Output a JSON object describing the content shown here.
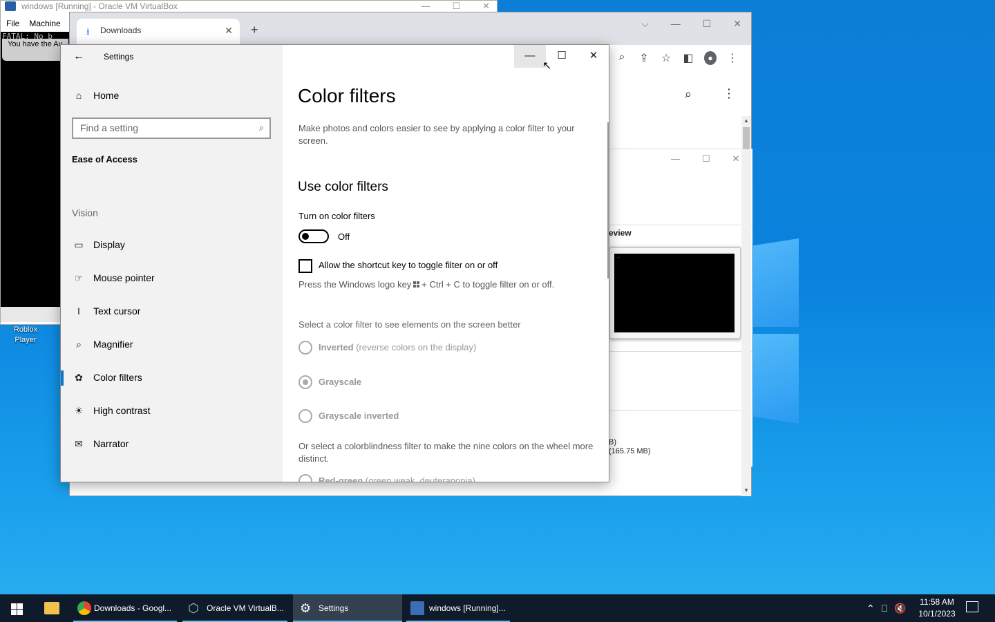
{
  "virtualbox": {
    "title": "windows [Running] - Oracle VM VirtualBox",
    "menu": [
      "File",
      "Machine"
    ],
    "screen_text": "FATAL: No b",
    "banner_text": "You have the Au"
  },
  "desktop_icons": [
    {
      "label": "Roblox Player"
    }
  ],
  "chrome": {
    "tab_title": "Downloads",
    "inner_section": "eview",
    "size_line1": "B)",
    "size_line2": "(165.75 MB)"
  },
  "settings": {
    "app_title": "Settings",
    "home_label": "Home",
    "search_placeholder": "Find a setting",
    "category": "Ease of Access",
    "group_label": "Vision",
    "nav_items": [
      {
        "label": "Display",
        "icon": "display-icon"
      },
      {
        "label": "Mouse pointer",
        "icon": "mouse-pointer-icon"
      },
      {
        "label": "Text cursor",
        "icon": "text-cursor-icon"
      },
      {
        "label": "Magnifier",
        "icon": "magnifier-icon"
      },
      {
        "label": "Color filters",
        "icon": "color-filters-icon",
        "active": true
      },
      {
        "label": "High contrast",
        "icon": "high-contrast-icon"
      },
      {
        "label": "Narrator",
        "icon": "narrator-icon"
      }
    ],
    "page_title": "Color filters",
    "page_desc": "Make photos and colors easier to see by applying a color filter to your screen.",
    "section_title": "Use color filters",
    "toggle_label": "Turn on color filters",
    "toggle_state": "Off",
    "shortcut_label": "Allow the shortcut key to toggle filter on or off",
    "hint_pre": "Press the Windows logo key",
    "hint_post": "+ Ctrl + C to toggle filter on or off.",
    "select_label": "Select a color filter to see elements on the screen better",
    "filters": [
      {
        "name": "Inverted",
        "desc": "(reverse colors on the display)",
        "checked": false
      },
      {
        "name": "Grayscale",
        "desc": "",
        "checked": true
      },
      {
        "name": "Grayscale inverted",
        "desc": "",
        "checked": false
      }
    ],
    "colorblind_label": "Or select a colorblindness filter to make the nine colors on the wheel more distinct.",
    "partial_option": "Red-green",
    "partial_option_desc": "(green weak, deuteranopia)"
  },
  "taskbar": {
    "items": [
      {
        "label": "Downloads - Googl...",
        "icon": "chrome-icon"
      },
      {
        "label": "Oracle VM VirtualB...",
        "icon": "virtualbox-icon"
      },
      {
        "label": "Settings",
        "icon": "gear-icon"
      },
      {
        "label": "windows [Running]...",
        "icon": "vm-icon"
      }
    ],
    "time": "11:58 AM",
    "date": "10/1/2023"
  },
  "colors": {
    "accent": "#0078d4",
    "taskbar": "#0f1b2b"
  }
}
